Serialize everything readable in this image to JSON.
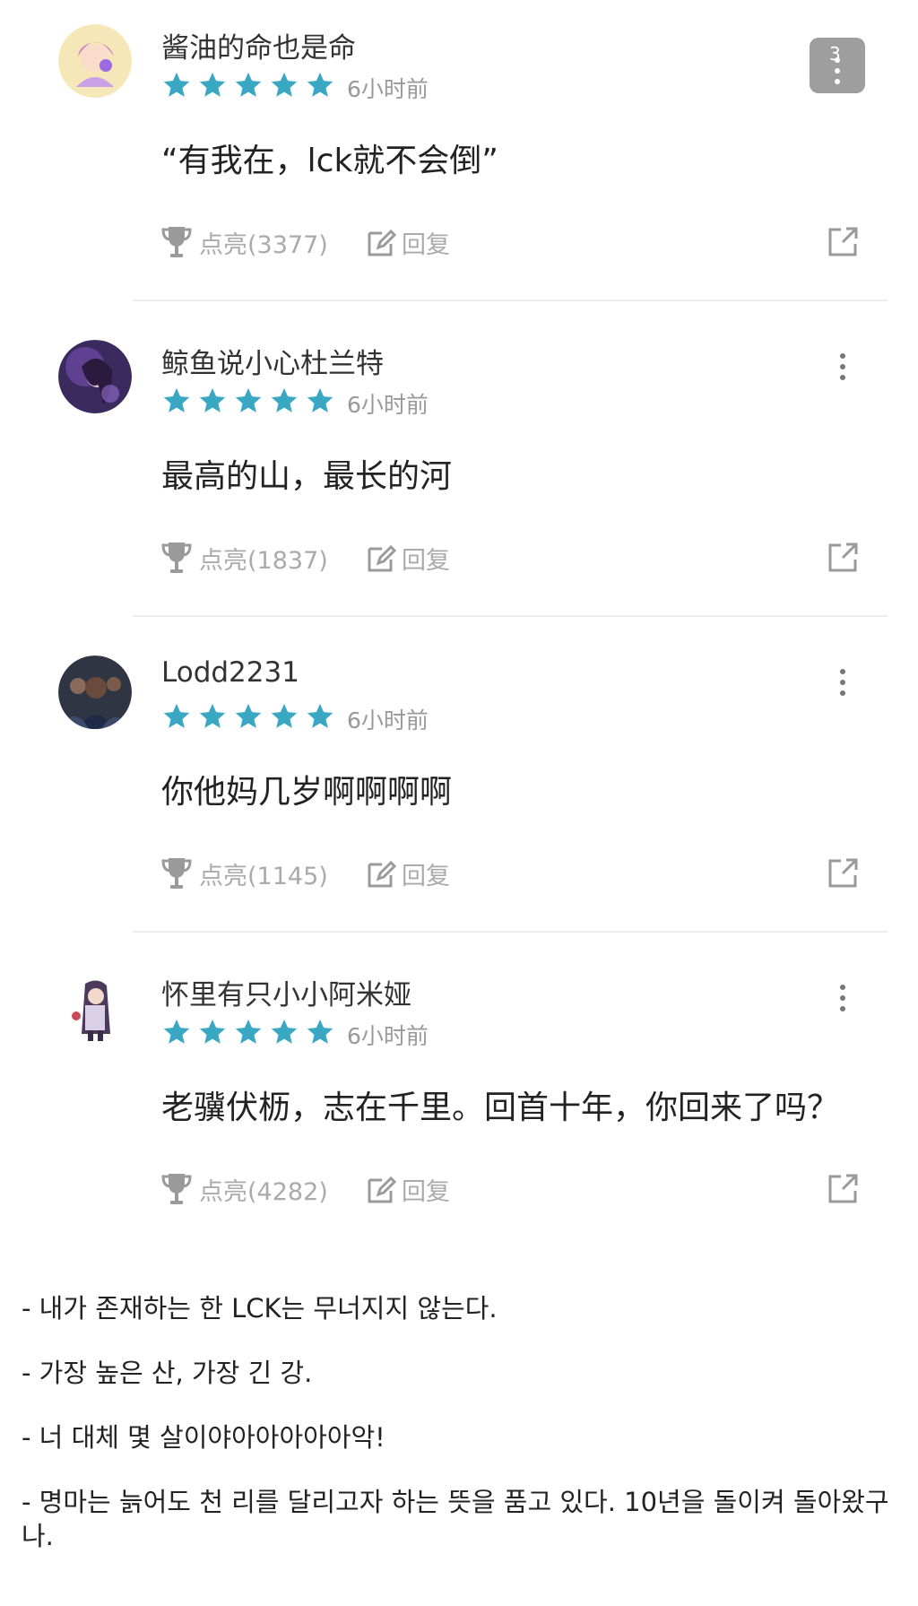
{
  "page_badge": "3",
  "comments": [
    {
      "username": "酱油的命也是命",
      "rating_stars": 5,
      "time": "6小时前",
      "content": "“有我在，lck就不会倒”",
      "like_label": "点亮(3377)",
      "reply_label": "回复"
    },
    {
      "username": "鲸鱼说小心杜兰特",
      "rating_stars": 5,
      "time": "6小时前",
      "content": "最高的山，最长的河",
      "like_label": "点亮(1837)",
      "reply_label": "回复"
    },
    {
      "username": "Lodd2231",
      "rating_stars": 5,
      "time": "6小时前",
      "content": "你他妈几岁啊啊啊啊",
      "like_label": "点亮(1145)",
      "reply_label": "回复"
    },
    {
      "username": "怀里有只小小阿米娅",
      "rating_stars": 5,
      "time": "6小时前",
      "content": "老骥伏枥，志在千里。回首十年，你回来了吗？",
      "like_label": "点亮(4282)",
      "reply_label": "回复"
    }
  ],
  "translations": [
    "- 내가 존재하는 한 LCK는 무너지지 않는다.",
    "- 가장 높은 산, 가장 긴 강.",
    "- 너 대체 몇 살이야아아아아아악!",
    "- 명마는 늙어도 천 리를 달리고자 하는 뜻을 품고 있다. 10년을 돌이켜 돌아왔구나."
  ],
  "colors": {
    "star": "#3aa7c4",
    "meta_text": "#999999",
    "action_icon": "#9a9a9a",
    "divider": "#ececec",
    "badge": "#9e9e9e"
  },
  "icons": {
    "like": "trophy-icon",
    "reply": "edit-icon",
    "share": "share-icon",
    "more": "more-vertical-icon",
    "star": "star-icon"
  }
}
